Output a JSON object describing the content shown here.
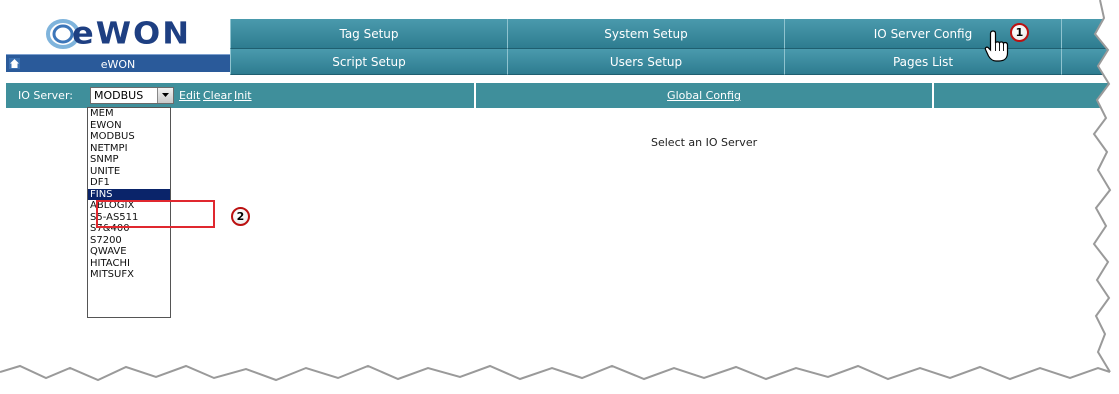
{
  "logo": {
    "text": "eWON"
  },
  "home": {
    "label": "eWON"
  },
  "menu": {
    "row1": [
      "Tag Setup",
      "System Setup",
      "IO Server Config"
    ],
    "row2": [
      "Script Setup",
      "Users Setup",
      "Pages List"
    ]
  },
  "io_bar": {
    "label": "IO Server:",
    "selected": "MODBUS",
    "links": {
      "edit": "Edit",
      "clear": "Clear",
      "init": "Init"
    },
    "global_config": "Global Config"
  },
  "dropdown": {
    "options": [
      "MEM",
      "EWON",
      "MODBUS",
      "NETMPI",
      "SNMP",
      "UNITE",
      "DF1",
      "FINS",
      "ABLOGIX",
      "S5-AS511",
      "S7&400",
      "S7200",
      "QWAVE",
      "HITACHI",
      "MITSUFX"
    ],
    "highlighted": "FINS"
  },
  "main": {
    "message": "Select an IO Server"
  },
  "annotations": {
    "callout1": "1",
    "callout2": "2"
  },
  "colors": {
    "menu": "#2e7c90",
    "highlight_box": "#e0282f",
    "selection": "#0a246a"
  }
}
